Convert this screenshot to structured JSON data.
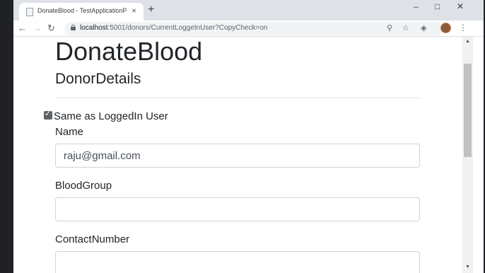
{
  "browser": {
    "tab_title": "DonateBlood - TestApplicationP",
    "tab_close": "×",
    "new_tab": "+",
    "window_controls": {
      "minimize": "–",
      "maximize": "□",
      "close": "✕"
    },
    "url_host": "localhost",
    "url_path": ":5001/donors/CurrentLoggeInUser?CopyCheck=on",
    "nav": {
      "back": "←",
      "forward": "→",
      "reload": "↻"
    },
    "omnibox_icons": {
      "zoom": "⚲",
      "bookmark": "☆",
      "extension": "◈"
    },
    "menu": "⋮"
  },
  "page": {
    "app_title": "DonateBlood",
    "section_title": "DonorDetails",
    "copy_check": {
      "label": "Same as LoggedIn User",
      "checked": true
    },
    "fields": [
      {
        "label": "Name",
        "value": "raju@gmail.com"
      },
      {
        "label": "BloodGroup",
        "value": ""
      },
      {
        "label": "ContactNumber",
        "value": ""
      }
    ]
  },
  "colors": {
    "text": "#212529",
    "input_border": "#ced4da",
    "chrome_bar": "#dee1e6"
  }
}
